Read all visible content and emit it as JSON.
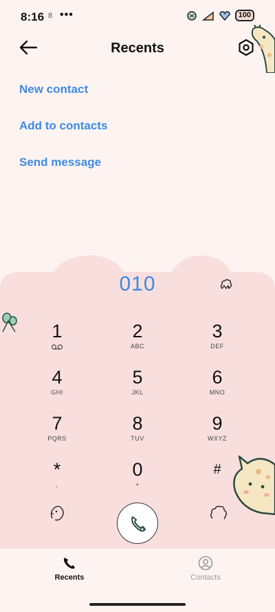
{
  "status_bar": {
    "time": "8:16",
    "notification_glyph": "8",
    "dots": "•••",
    "battery": "100",
    "icons": [
      "theme-sticker-icon",
      "signal-icon",
      "wifi-heart-icon",
      "battery-icon"
    ]
  },
  "header": {
    "title": "Recents",
    "back_icon": "arrow-left-icon",
    "settings_icon": "hexagon-settings-icon"
  },
  "actions": [
    {
      "label": "New contact"
    },
    {
      "label": "Add to contacts"
    },
    {
      "label": "Send message"
    }
  ],
  "dialer": {
    "number": "010",
    "keys": [
      {
        "digit": "1",
        "letters": "voicemail"
      },
      {
        "digit": "2",
        "letters": "ABC"
      },
      {
        "digit": "3",
        "letters": "DEF"
      },
      {
        "digit": "4",
        "letters": "GHI"
      },
      {
        "digit": "5",
        "letters": "JKL"
      },
      {
        "digit": "6",
        "letters": "MNO"
      },
      {
        "digit": "7",
        "letters": "PQRS"
      },
      {
        "digit": "8",
        "letters": "TUV"
      },
      {
        "digit": "9",
        "letters": "WXYZ"
      },
      {
        "digit": "*",
        "letters": ","
      },
      {
        "digit": "0",
        "letters": "+"
      },
      {
        "digit": "#",
        "letters": ""
      }
    ]
  },
  "bottom_nav": {
    "tabs": [
      {
        "label": "Recents",
        "active": true
      },
      {
        "label": "Contacts",
        "active": false
      }
    ]
  },
  "colors": {
    "accent": "#3d8ae0",
    "keypad_bg": "#f8dfde",
    "page_bg": "#fdf4f2"
  }
}
